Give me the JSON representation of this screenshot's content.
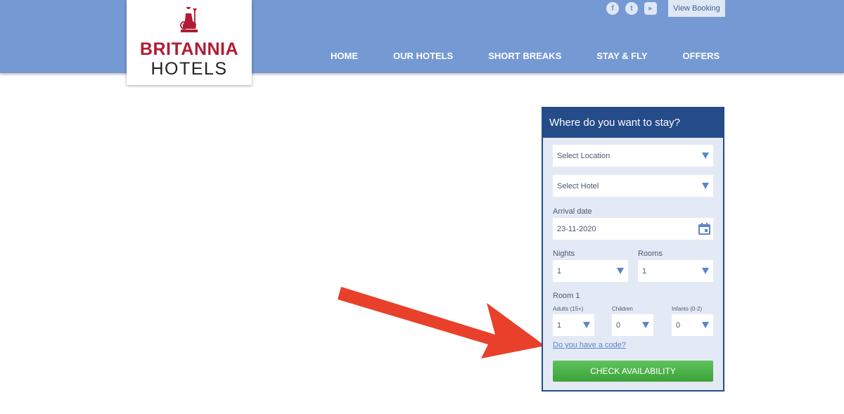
{
  "header": {
    "logo": {
      "word1": "BRITANNIA",
      "word2": "HOTELS"
    },
    "social": [
      {
        "name": "facebook-icon",
        "glyph": "f"
      },
      {
        "name": "twitter-icon",
        "glyph": "t"
      },
      {
        "name": "youtube-icon",
        "glyph": "▶"
      }
    ],
    "view_booking": "View Booking",
    "nav": [
      "HOME",
      "OUR HOTELS",
      "SHORT BREAKS",
      "STAY & FLY",
      "OFFERS"
    ]
  },
  "widget": {
    "title": "Where do you want to stay?",
    "location_placeholder": "Select Location",
    "hotel_placeholder": "Select Hotel",
    "arrival_label": "Arrival date",
    "arrival_value": "23-11-2020",
    "nights_label": "Nights",
    "nights_value": "1",
    "rooms_label": "Rooms",
    "rooms_value": "1",
    "room_label": "Room 1",
    "adults_label": "Adults (15+)",
    "adults_value": "1",
    "children_label": "Children",
    "children_value": "0",
    "infants_label": "Infants (0-2)",
    "infants_value": "0",
    "code_link": "Do you have a code?",
    "check_button": "CHECK AVAILABILITY"
  },
  "colors": {
    "header_bg": "#7499d3",
    "widget_border": "#254c89",
    "brand_red": "#b01c34",
    "button_green": "#4cb049",
    "arrow_red": "#e8402a"
  }
}
